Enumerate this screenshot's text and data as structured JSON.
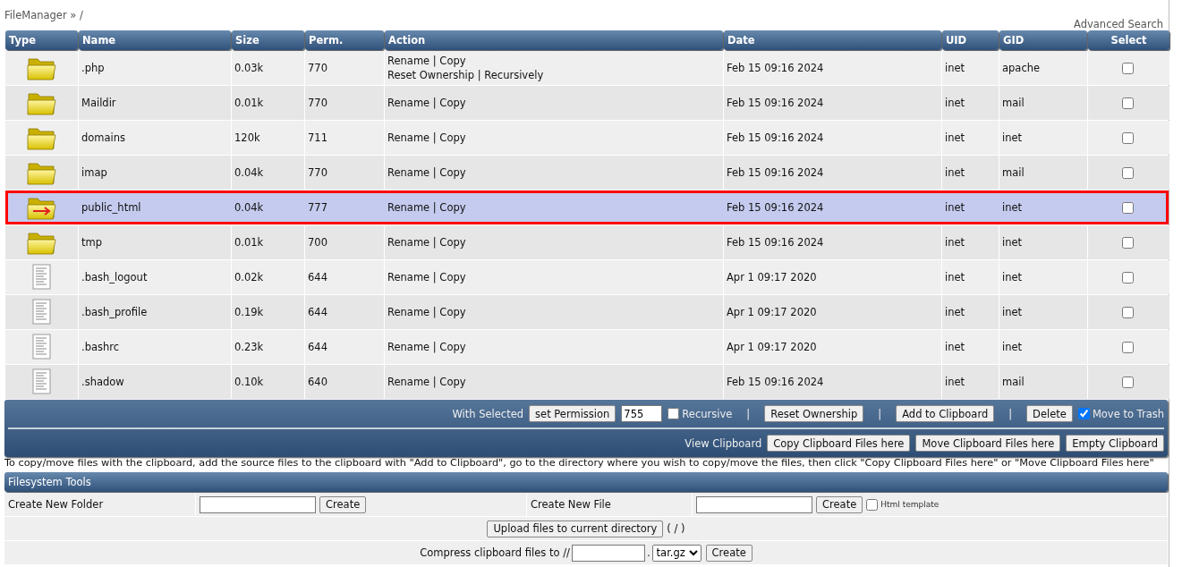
{
  "breadcrumb": "FileManager » /",
  "advanced_search": "Advanced Search",
  "table": {
    "columns": [
      "Type",
      "Name",
      "Size",
      "Perm.",
      "Action",
      "Date",
      "UID",
      "GID",
      "Select"
    ],
    "action_separator": "|",
    "rows": [
      {
        "kind": "folder",
        "name": ".php",
        "size": "0.03k",
        "perm": "770",
        "actions": [
          [
            "Rename",
            "Copy"
          ],
          [
            "Reset Ownership",
            "Recursively"
          ]
        ],
        "date": "Feb 15 09:16 2024",
        "uid": "inet",
        "gid": "apache",
        "checked": false,
        "selected": false
      },
      {
        "kind": "folder",
        "name": "Maildir",
        "size": "0.01k",
        "perm": "770",
        "actions": [
          [
            "Rename",
            "Copy"
          ]
        ],
        "date": "Feb 15 09:16 2024",
        "uid": "inet",
        "gid": "mail",
        "checked": false,
        "selected": false
      },
      {
        "kind": "folder",
        "name": "domains",
        "size": "120k",
        "perm": "711",
        "actions": [
          [
            "Rename",
            "Copy"
          ]
        ],
        "date": "Feb 15 09:16 2024",
        "uid": "inet",
        "gid": "inet",
        "checked": false,
        "selected": false
      },
      {
        "kind": "folder",
        "name": "imap",
        "size": "0.04k",
        "perm": "770",
        "actions": [
          [
            "Rename",
            "Copy"
          ]
        ],
        "date": "Feb 15 09:16 2024",
        "uid": "inet",
        "gid": "mail",
        "checked": false,
        "selected": false
      },
      {
        "kind": "link",
        "name": "public_html",
        "size": "0.04k",
        "perm": "777",
        "actions": [
          [
            "Rename",
            "Copy"
          ]
        ],
        "date": "Feb 15 09:16 2024",
        "uid": "inet",
        "gid": "inet",
        "checked": false,
        "selected": true
      },
      {
        "kind": "folder",
        "name": "tmp",
        "size": "0.01k",
        "perm": "700",
        "actions": [
          [
            "Rename",
            "Copy"
          ]
        ],
        "date": "Feb 15 09:16 2024",
        "uid": "inet",
        "gid": "inet",
        "checked": false,
        "selected": false
      },
      {
        "kind": "file",
        "name": ".bash_logout",
        "size": "0.02k",
        "perm": "644",
        "actions": [
          [
            "Rename",
            "Copy"
          ]
        ],
        "date": "Apr 1 09:17 2020",
        "uid": "inet",
        "gid": "inet",
        "checked": false,
        "selected": false
      },
      {
        "kind": "file",
        "name": ".bash_profile",
        "size": "0.19k",
        "perm": "644",
        "actions": [
          [
            "Rename",
            "Copy"
          ]
        ],
        "date": "Apr 1 09:17 2020",
        "uid": "inet",
        "gid": "inet",
        "checked": false,
        "selected": false
      },
      {
        "kind": "file",
        "name": ".bashrc",
        "size": "0.23k",
        "perm": "644",
        "actions": [
          [
            "Rename",
            "Copy"
          ]
        ],
        "date": "Apr 1 09:17 2020",
        "uid": "inet",
        "gid": "inet",
        "checked": false,
        "selected": false
      },
      {
        "kind": "file",
        "name": ".shadow",
        "size": "0.10k",
        "perm": "640",
        "actions": [
          [
            "Rename",
            "Copy"
          ]
        ],
        "date": "Feb 15 09:16 2024",
        "uid": "inet",
        "gid": "mail",
        "checked": false,
        "selected": false
      }
    ]
  },
  "bulk_actions": [
    {
      "kind": "label",
      "text": "With Selected"
    },
    {
      "kind": "button",
      "text": "set Permission"
    },
    {
      "kind": "input",
      "value": "755"
    },
    {
      "kind": "checkbox",
      "text": "Recursive",
      "checked": false
    },
    {
      "kind": "separator",
      "text": "|"
    },
    {
      "kind": "button",
      "text": "Reset Ownership"
    },
    {
      "kind": "separator",
      "text": "|"
    },
    {
      "kind": "button",
      "text": "Add to Clipboard"
    },
    {
      "kind": "separator",
      "text": "|"
    },
    {
      "kind": "button",
      "text": "Delete"
    },
    {
      "kind": "checkbox",
      "text": "Move to Trash",
      "checked": true
    }
  ],
  "clipboard": {
    "label": "View Clipboard",
    "buttons": [
      "Copy Clipboard Files here",
      "Move Clipboard Files here",
      "Empty Clipboard"
    ]
  },
  "note": "To copy/move files with the clipboard, add the source files to the clipboard with \"Add to Clipboard\", go to the directory where you wish to copy/move the files, then click \"Copy Clipboard Files here\" or \"Move Clipboard Files here\"",
  "filesystem_tools": {
    "title": "Filesystem Tools",
    "new_folder": {
      "label": "Create New Folder",
      "button": "Create"
    },
    "new_file": {
      "label": "Create New File",
      "button": "Create",
      "template": {
        "label": "Html template",
        "checked": false
      }
    },
    "upload": {
      "button": "Upload files to current directory",
      "path": "( / )"
    },
    "compress": {
      "label": "Compress clipboard files to //",
      "dot": ".",
      "format": "tar.gz",
      "button": "Create"
    }
  }
}
